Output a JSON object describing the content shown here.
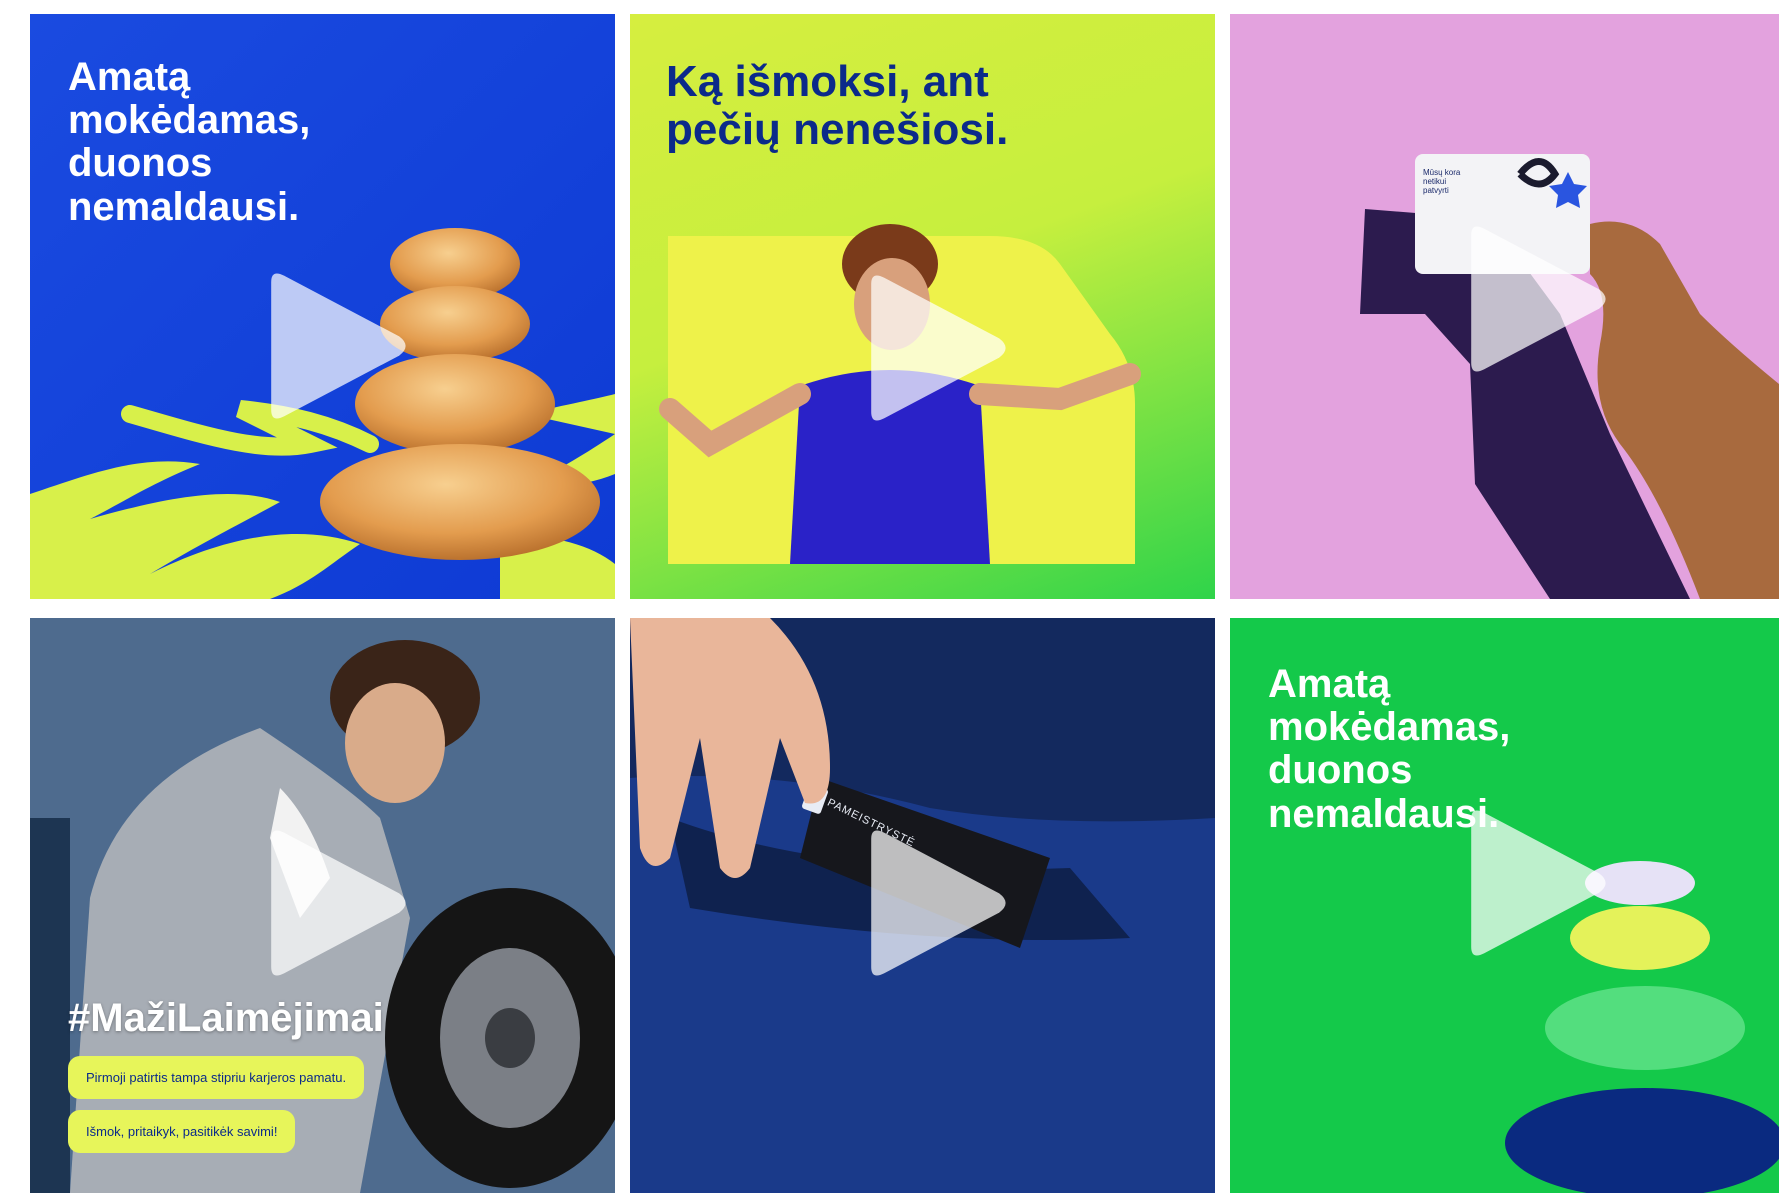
{
  "tiles": [
    {
      "headline": "Amatą\nmokėdamas,\nduonos\nnemaldausi.",
      "colors": {
        "background": "#1a4be0",
        "flames": "#d8f04a",
        "bread": "#e7a85a"
      },
      "icons": [
        "play-icon"
      ]
    },
    {
      "headline": "Ką išmoksi, ant\npečių nenešiosi.",
      "colors": {
        "background": "#d6ee3f",
        "frame": "#eef24a",
        "shirt": "#2a22c8"
      },
      "icons": [
        "play-icon"
      ]
    },
    {
      "card_text": "Mūsų kora\nnetikui\npatvyrti",
      "colors": {
        "background": "#e3a2de",
        "shadow": "#2c1b4e",
        "star": "#2a55e0"
      },
      "icons": [
        "play-icon"
      ]
    },
    {
      "hashtag": "#MažiLaimėjimai",
      "pill_1": "Pirmoji patirtis tampa stipriu karjeros pamatu.",
      "pill_2": "Išmok, pritaikyk, pasitikėk savimi!",
      "colors": {
        "pill": "#e7f55a"
      },
      "icons": [
        "play-icon"
      ]
    },
    {
      "tag_text": "PAMEISTRYSTĖ",
      "colors": {
        "background": "#13295e"
      },
      "icons": [
        "play-icon"
      ]
    },
    {
      "headline": "Amatą\nmokėdamas,\nduonos\nnemaldausi.",
      "colors": {
        "background": "#14c94a",
        "stack_1": "#e6e2f6",
        "stack_2": "#e4f25a",
        "stack_3": "#53de7e",
        "stack_4": "#0a2a80"
      },
      "icons": [
        "play-icon"
      ]
    }
  ]
}
